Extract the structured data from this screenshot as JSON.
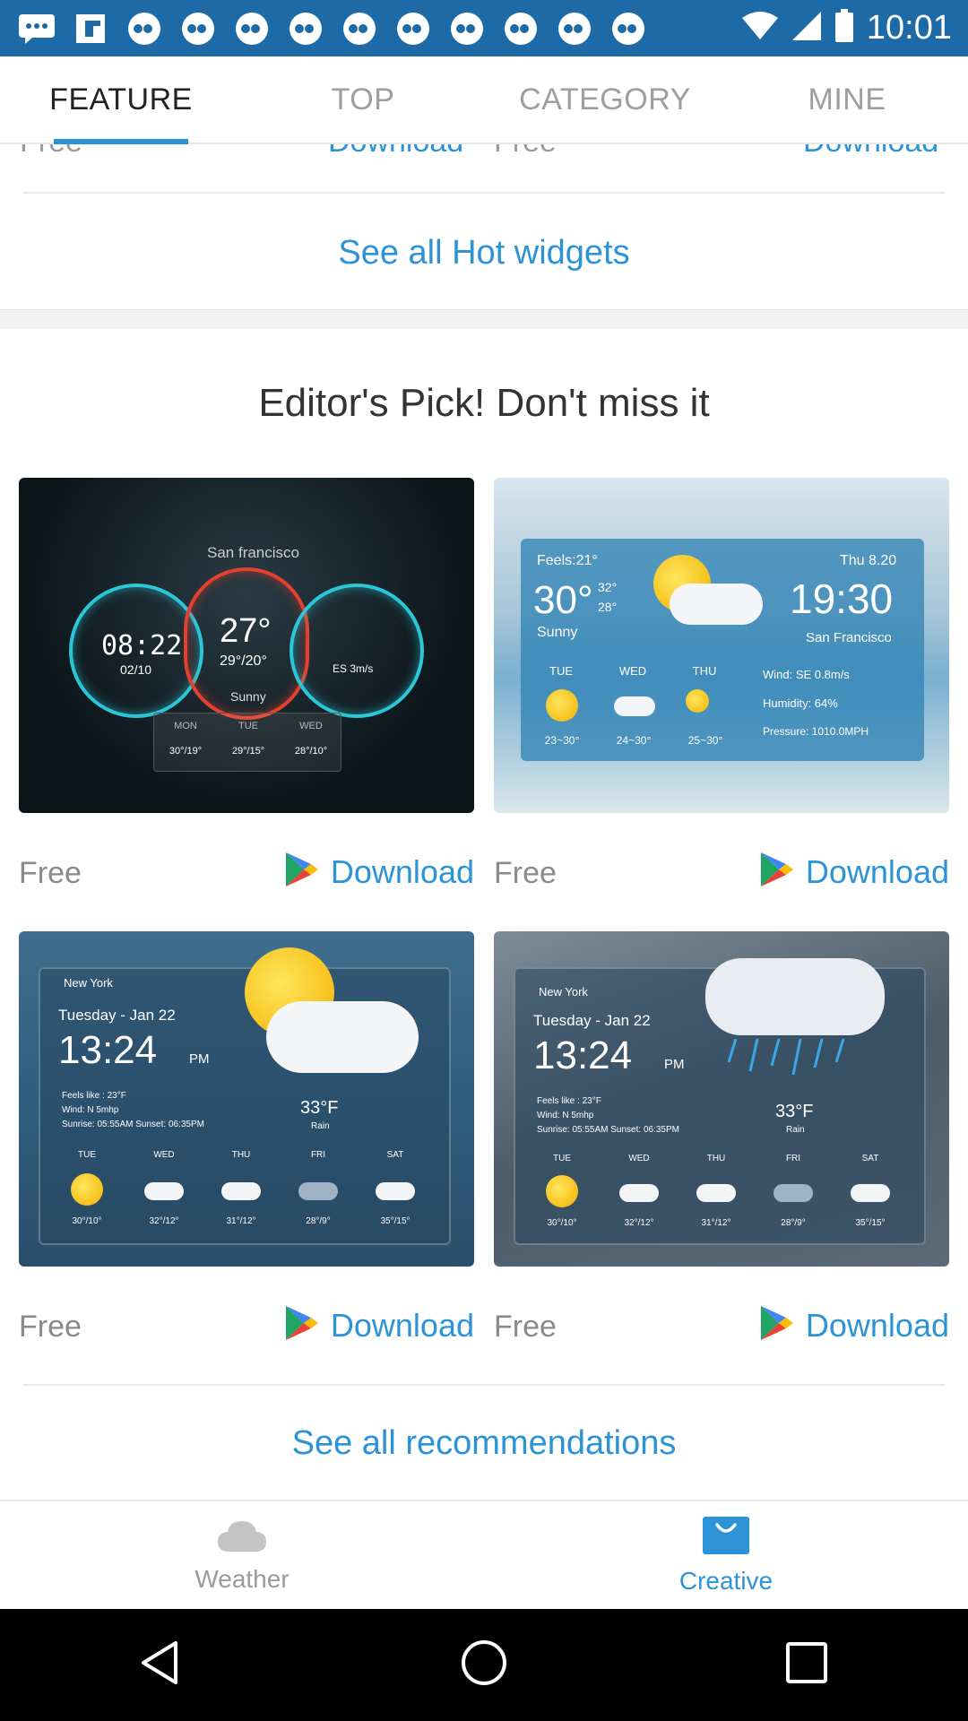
{
  "status_bar": {
    "time": "10:01",
    "notification_icons": [
      "message-icon",
      "flipboard-icon",
      "abc-icon",
      "abc-icon",
      "abc-icon",
      "abc-icon",
      "abc-icon",
      "abc-icon",
      "abc-icon",
      "abc-icon",
      "abc-icon",
      "abc-icon"
    ]
  },
  "tabs": [
    {
      "label": "FEATURE",
      "active": true
    },
    {
      "label": "TOP",
      "active": false
    },
    {
      "label": "CATEGORY",
      "active": false
    },
    {
      "label": "MINE",
      "active": false
    }
  ],
  "hot_widgets": {
    "partial_price_left": "Free",
    "partial_download_left": "Download",
    "partial_price_right": "Free",
    "partial_download_right": "Download",
    "see_all": "See all Hot widgets"
  },
  "editors_pick": {
    "title": "Editor's Pick! Don't miss it",
    "cards": [
      {
        "price": "Free",
        "download": "Download",
        "art": {
          "city": "San francisco",
          "time": "08:22",
          "date": "02/10",
          "temp": "27°",
          "range": "29°/20°",
          "cond": "Sunny",
          "wind": "ES 3m/s",
          "days": [
            "MON",
            "TUE",
            "WED"
          ],
          "temps": [
            "30°/19°",
            "29°/15°",
            "28°/10°"
          ]
        }
      },
      {
        "price": "Free",
        "download": "Download",
        "art": {
          "feels": "Feels:21°",
          "temp": "30°",
          "hi": "32°",
          "lo": "28°",
          "cond": "Sunny",
          "date": "Thu 8.20",
          "time": "19:30",
          "city": "San Francisco",
          "wind": "Wind:  SE 0.8m/s",
          "humidity": "Humidity:  64%",
          "pressure": "Pressure: 1010.0MPH",
          "days": [
            "TUE",
            "WED",
            "THU"
          ],
          "ranges": [
            "23~30°",
            "24~30°",
            "25~30°"
          ]
        }
      },
      {
        "price": "Free",
        "download": "Download",
        "art": {
          "city": "New York",
          "date": "Tuesday - Jan 22",
          "time": "13:24",
          "ampm": "PM",
          "feels": "Feels like : 23°F",
          "wind": "Wind: N 5mhp",
          "sun": "Sunrise: 05:55AM   Sunset: 06:35PM",
          "temp": "33°F",
          "cond": "Rain",
          "days": [
            "TUE",
            "WED",
            "THU",
            "FRI",
            "SAT"
          ],
          "temps": [
            "30°/10°",
            "32°/12°",
            "31°/12°",
            "28°/9°",
            "35°/15°"
          ]
        }
      },
      {
        "price": "Free",
        "download": "Download",
        "art": {
          "city": "New York",
          "date": "Tuesday - Jan 22",
          "time": "13:24",
          "ampm": "PM",
          "feels": "Feels like : 23°F",
          "wind": "Wind: N 5mhp",
          "sun": "Sunrise: 05:55AM   Sunset: 06:35PM",
          "temp": "33°F",
          "cond": "Rain",
          "days": [
            "TUE",
            "WED",
            "THU",
            "FRI",
            "SAT"
          ],
          "temps": [
            "30°/10°",
            "32°/12°",
            "31°/12°",
            "28°/9°",
            "35°/15°"
          ]
        }
      }
    ],
    "see_all": "See all recommendations"
  },
  "bottom_nav": [
    {
      "label": "Weather",
      "icon": "cloud-icon",
      "active": false
    },
    {
      "label": "Creative",
      "icon": "shopping-bag-icon",
      "active": true
    }
  ],
  "colors": {
    "accent": "#2b93d6",
    "status_bar": "#1e6aa6",
    "inactive_text": "#9e9e9e"
  }
}
